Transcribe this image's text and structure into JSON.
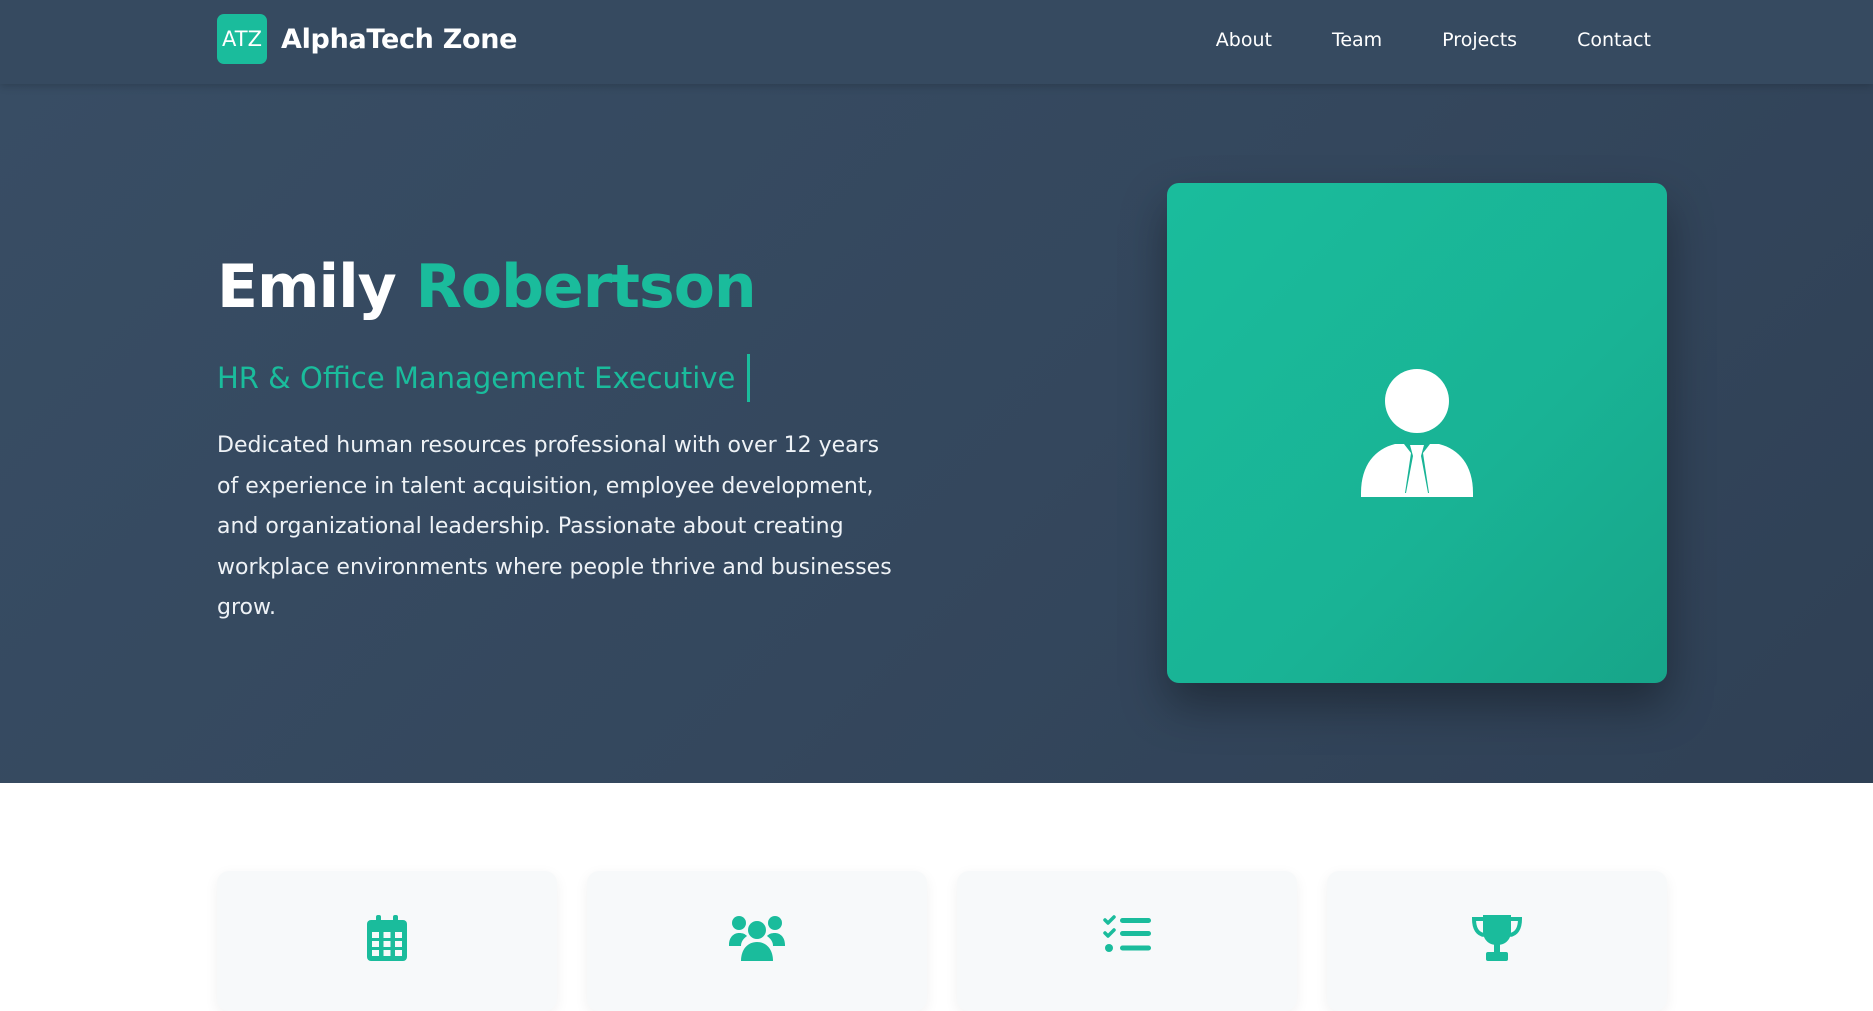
{
  "brand": {
    "badge": "ATZ",
    "name": "AlphaTech Zone",
    "accent_color": "#1abc9c"
  },
  "nav": {
    "items": [
      {
        "label": "About"
      },
      {
        "label": "Team"
      },
      {
        "label": "Projects"
      },
      {
        "label": "Contact"
      }
    ]
  },
  "hero": {
    "first_name": "Emily",
    "last_name": "Robertson",
    "role": "HR & Office Management Executive",
    "description": "Dedicated human resources professional with over 12 years of experience in talent acquisition, employee development, and organizational leadership. Passionate about creating workplace environments where people thrive and businesses grow.",
    "avatar_icon": "user-tie-icon"
  },
  "features": {
    "icons": [
      "calendar-icon",
      "users-icon",
      "tasks-icon",
      "trophy-icon"
    ]
  }
}
